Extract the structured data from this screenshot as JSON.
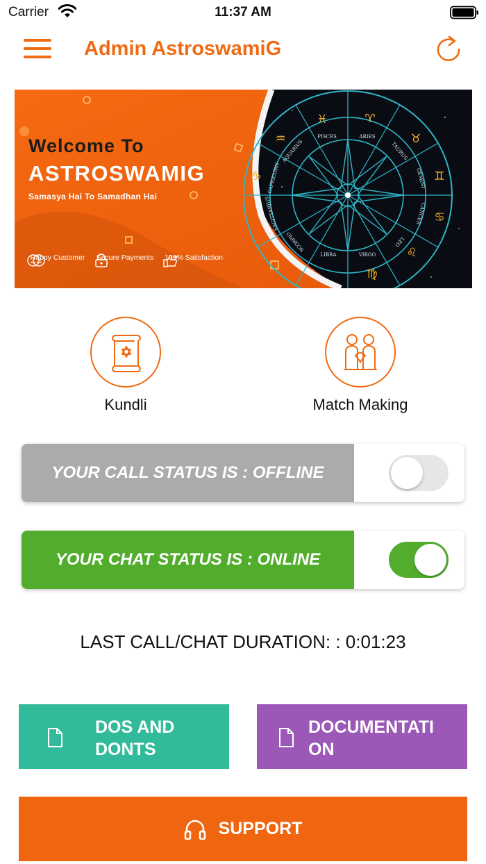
{
  "status_bar": {
    "carrier": "Carrier",
    "time": "11:37 AM"
  },
  "app_bar": {
    "title": "Admin AstroswamiG"
  },
  "banner": {
    "welcome": "Welcome To",
    "brand": "ASTROSWAMIG",
    "tagline": "Samasya Hai To Samadhan Hai",
    "features": [
      "Happy Customer",
      "Secure Payments",
      "100% Satisfaction"
    ],
    "zodiac_signs": [
      "ARIES",
      "TAURUS",
      "GEMINI",
      "CANCER",
      "LEO",
      "VIRGO",
      "LIBRA",
      "SCORPIO",
      "SAGITTARIUS",
      "CAPRICORN",
      "AQUARIUS",
      "PISCES"
    ]
  },
  "services": [
    {
      "label": "Kundli",
      "icon": "scroll-icon"
    },
    {
      "label": "Match Making",
      "icon": "couple-icon"
    }
  ],
  "call_status": {
    "text": "YOUR CALL STATUS IS : OFFLINE",
    "on": false,
    "color": "#ababab"
  },
  "chat_status": {
    "text": "YOUR CHAT STATUS IS : ONLINE",
    "on": true,
    "color": "#52ad2d"
  },
  "duration": "LAST CALL/CHAT DURATION: : 0:01:23",
  "actions": [
    {
      "label": "DOS AND DONTS",
      "color": "#31bb9a",
      "icon": "document-icon"
    },
    {
      "label": "DOCUMENTATION",
      "color": "#9b58b6",
      "icon": "document-icon"
    }
  ],
  "support": {
    "label": "SUPPORT",
    "color": "#f0650f",
    "icon": "headphones-icon"
  },
  "colors": {
    "accent": "#ef6a12"
  }
}
